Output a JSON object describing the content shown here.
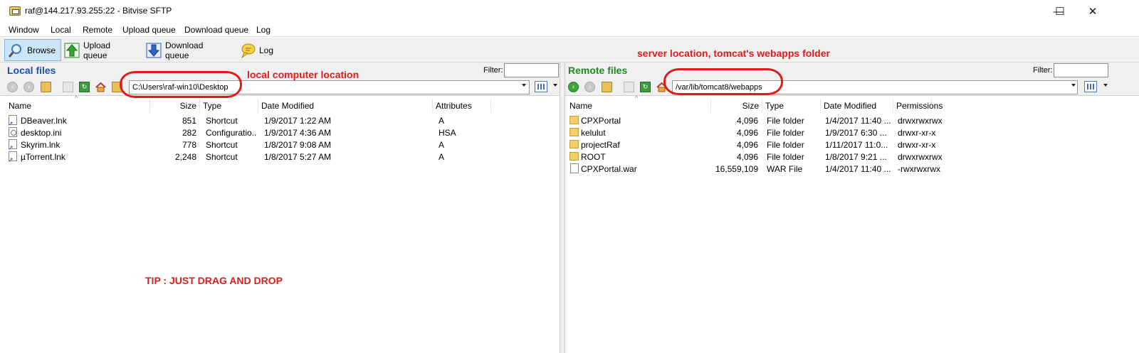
{
  "window": {
    "title": "raf@144.217.93.255:22 - Bitvise SFTP",
    "minimize_glyph": "—",
    "maximize_glyph": "☐",
    "close_glyph": "✕"
  },
  "menu": [
    "Window",
    "Local",
    "Remote",
    "Upload queue",
    "Download queue",
    "Log"
  ],
  "toolbar": {
    "browse": "Browse",
    "upload_queue": "Upload queue",
    "download_queue": "Download queue",
    "log": "Log"
  },
  "local": {
    "title": "Local files",
    "filter_label": "Filter:",
    "filter_value": "",
    "path": "C:\\Users\\raf-win10\\Desktop",
    "columns": [
      "Name",
      "Size",
      "Type",
      "Date Modified",
      "Attributes"
    ],
    "rows": [
      {
        "icon": "app-shortcut-icon",
        "name": "DBeaver.lnk",
        "size": "851",
        "type": "Shortcut",
        "date": "1/9/2017 1:22 AM",
        "attr": "A"
      },
      {
        "icon": "settings-file-icon",
        "name": "desktop.ini",
        "size": "282",
        "type": "Configuratio...",
        "date": "1/9/2017 4:36 AM",
        "attr": "HSA"
      },
      {
        "icon": "shortcut-icon",
        "name": "Skyrim.lnk",
        "size": "778",
        "type": "Shortcut",
        "date": "1/8/2017 9:08 AM",
        "attr": "A"
      },
      {
        "icon": "shortcut-icon",
        "name": "µTorrent.lnk",
        "size": "2,248",
        "type": "Shortcut",
        "date": "1/8/2017 5:27 AM",
        "attr": "A"
      }
    ]
  },
  "remote": {
    "title": "Remote files",
    "filter_label": "Filter:",
    "filter_value": "",
    "path": "/var/lib/tomcat8/webapps",
    "columns": [
      "Name",
      "Size",
      "Type",
      "Date Modified",
      "Permissions"
    ],
    "rows": [
      {
        "icon": "folder-icon",
        "name": "CPXPortal",
        "size": "4,096",
        "type": "File folder",
        "date": "1/4/2017 11:40 ...",
        "perm": "drwxrwxrwx"
      },
      {
        "icon": "folder-icon",
        "name": "kelulut",
        "size": "4,096",
        "type": "File folder",
        "date": "1/9/2017 6:30 ...",
        "perm": "drwxr-xr-x"
      },
      {
        "icon": "folder-icon",
        "name": "projectRaf",
        "size": "4,096",
        "type": "File folder",
        "date": "1/11/2017 11:0...",
        "perm": "drwxr-xr-x"
      },
      {
        "icon": "folder-icon",
        "name": "ROOT",
        "size": "4,096",
        "type": "File folder",
        "date": "1/8/2017 9:21 ...",
        "perm": "drwxrwxrwx"
      },
      {
        "icon": "file-icon",
        "name": "CPXPortal.war",
        "size": "16,559,109",
        "type": "WAR File",
        "date": "1/4/2017 11:40 ...",
        "perm": "-rwxrwxrwx"
      }
    ]
  },
  "annotations": {
    "local": "local computer location",
    "server": "server location, tomcat's webapps folder",
    "tip": "TIP : JUST DRAG AND DROP"
  },
  "colors": {
    "local_title": "#1c4fb0",
    "remote_title": "#1f8a1f",
    "annotation": "#e01b1b"
  }
}
